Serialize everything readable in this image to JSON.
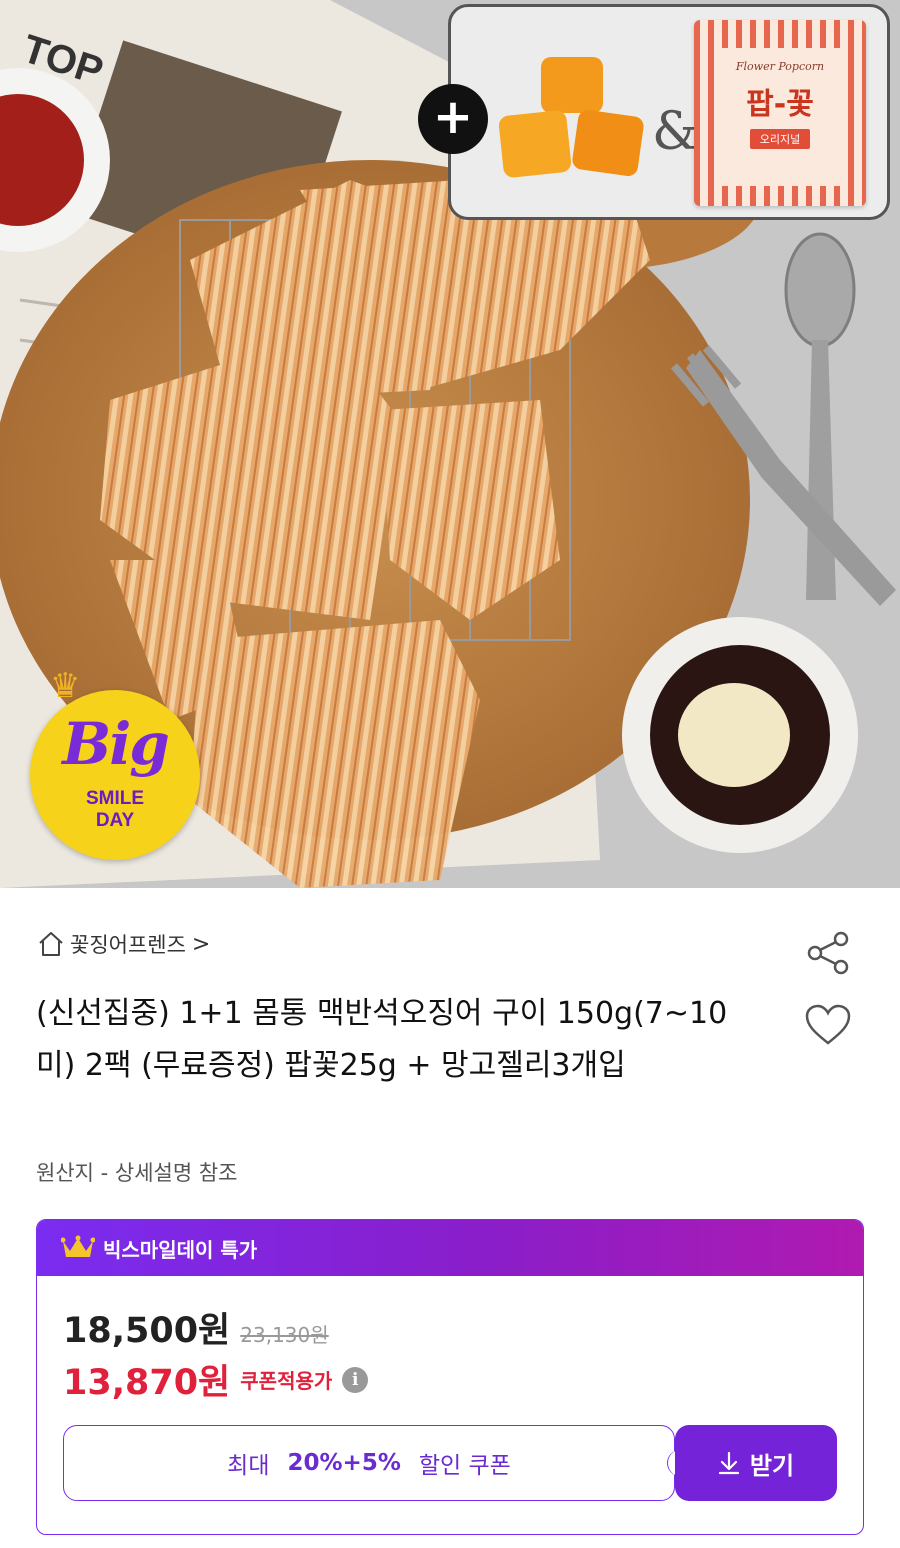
{
  "hero": {
    "badge": {
      "big": "Big",
      "smile": "SMILE",
      "day": "DAY"
    },
    "gift": {
      "plus": "+",
      "amp": "&",
      "pouch_brand": "Flower Popcorn",
      "pouch_title": "팝-꽃",
      "pouch_sub": "오리지널"
    }
  },
  "store": {
    "name": "꽃징어프렌즈",
    "chevron": ">"
  },
  "product": {
    "title": "(신선집중)  1+1 몸통 맥반석오징어 구이 150g(7~10미) 2팩 (무료증정) 팝꽃25g + 망고젤리3개입",
    "origin": "원산지 - 상세설명 참조"
  },
  "price_card": {
    "header_label": "빅스마일데이 특가",
    "price": "18,500원",
    "original_price": "23,130원",
    "coupon_price": "13,870원",
    "coupon_label": "쿠폰적용가",
    "info": "i",
    "coupon_button": {
      "prefix": "최대",
      "percent": "20%+5%",
      "suffix": "할인 쿠폰"
    },
    "get_button": "받기"
  },
  "colors": {
    "accent": "#7a2cf0",
    "sale": "#e0213b"
  }
}
